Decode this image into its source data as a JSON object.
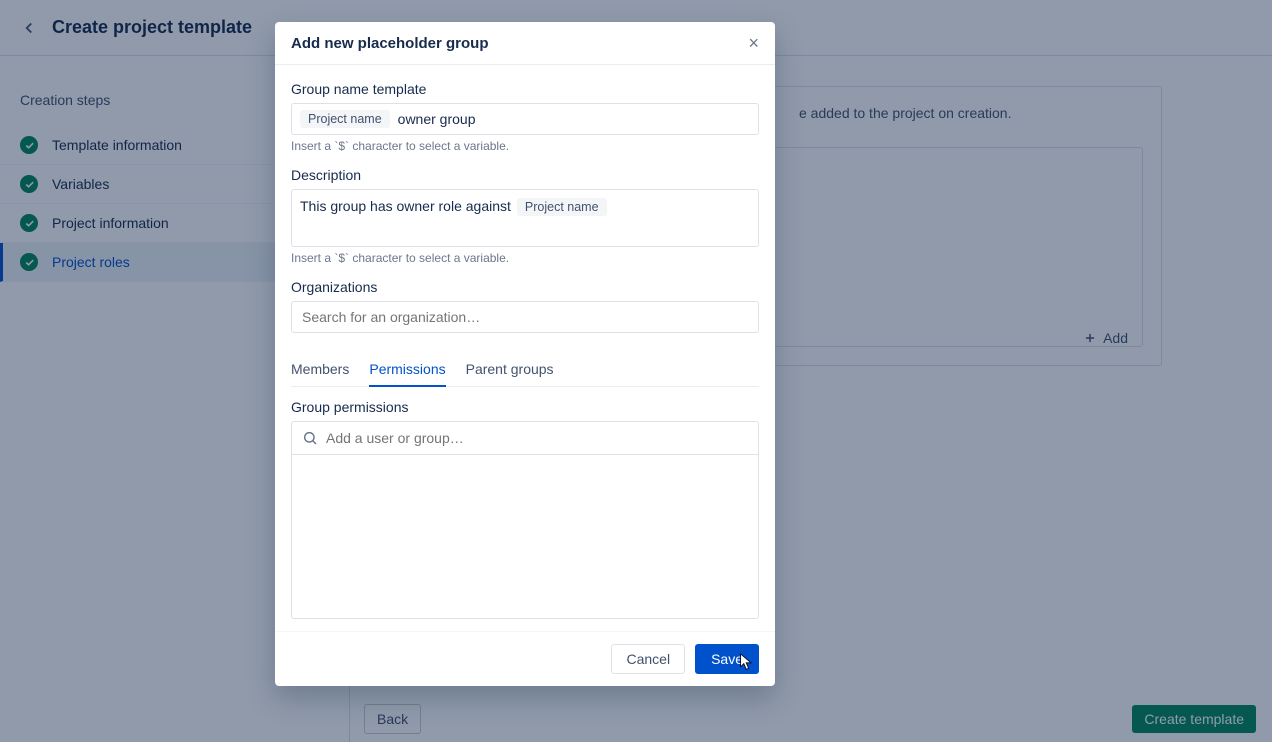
{
  "header": {
    "title": "Create project template"
  },
  "sidebar": {
    "title": "Creation steps",
    "steps": [
      {
        "label": "Template information"
      },
      {
        "label": "Variables"
      },
      {
        "label": "Project information"
      },
      {
        "label": "Project roles"
      }
    ]
  },
  "main": {
    "card_text_suffix": "e added to the project on creation.",
    "add_label": "Add",
    "back_label": "Back",
    "create_label": "Create template"
  },
  "modal": {
    "title": "Add new placeholder group",
    "group_name_label": "Group name template",
    "group_name_chip": "Project name",
    "group_name_value": "owner group",
    "hint": "Insert a `$` character to select a variable.",
    "description_label": "Description",
    "description_prefix": "This group has owner role against",
    "description_chip": "Project name",
    "org_label": "Organizations",
    "org_placeholder": "Search for an organization…",
    "tabs": {
      "members": "Members",
      "permissions": "Permissions",
      "parent": "Parent groups"
    },
    "perm_label": "Group permissions",
    "perm_placeholder": "Add a user or group…",
    "cancel": "Cancel",
    "save": "Save"
  }
}
